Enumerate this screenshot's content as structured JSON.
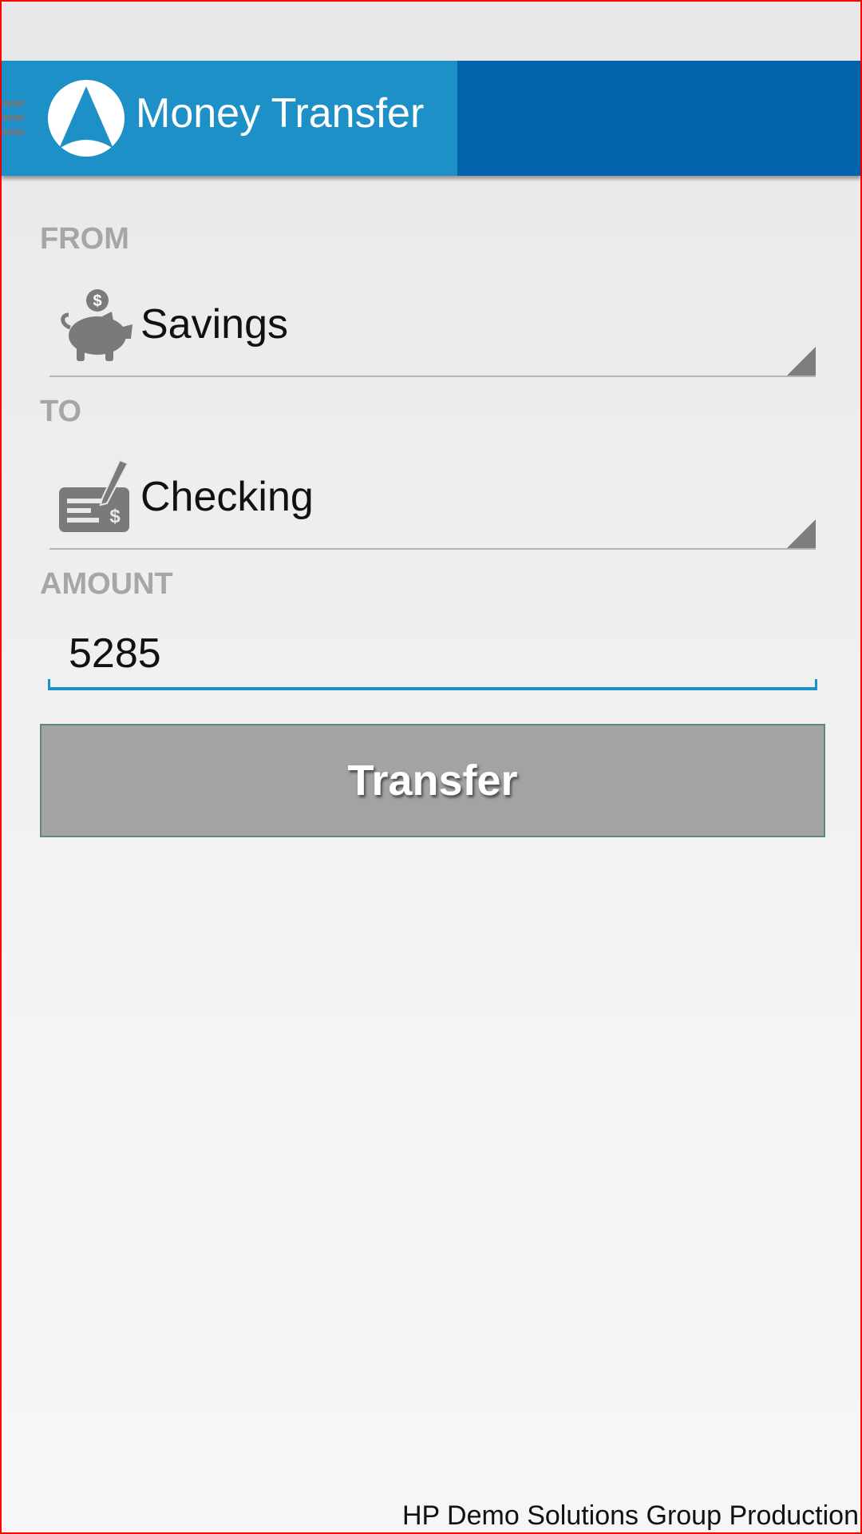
{
  "app_bar": {
    "title": "Money Transfer",
    "menu_icon": "hamburger-menu-icon",
    "logo_icon": "a-logo-icon",
    "color_left": "#1e90c8",
    "color_right": "#0063ab"
  },
  "form": {
    "from": {
      "label": "FROM",
      "value": "Savings",
      "icon": "piggy-bank-icon"
    },
    "to": {
      "label": "TO",
      "value": "Checking",
      "icon": "check-pen-icon"
    },
    "amount": {
      "label": "AMOUNT",
      "value": "5285"
    },
    "submit_label": "Transfer"
  },
  "footer": {
    "credit": "HP Demo Solutions Group Production"
  }
}
